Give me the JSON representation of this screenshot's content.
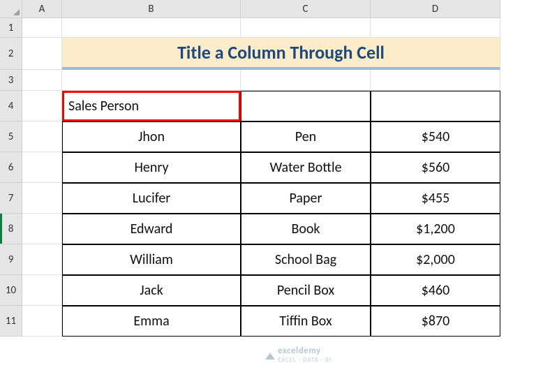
{
  "columns": {
    "A": "A",
    "B": "B",
    "C": "C",
    "D": "D"
  },
  "rows": {
    "r1": "1",
    "r2": "2",
    "r3": "3",
    "r4": "4",
    "r5": "5",
    "r6": "6",
    "r7": "7",
    "r8": "8",
    "r9": "9",
    "r10": "10",
    "r11": "11"
  },
  "title": "Title a Column Through Cell",
  "header_b4": "Sales Person",
  "data": [
    {
      "b": "Jhon",
      "c": "Pen",
      "d": "$540"
    },
    {
      "b": "Henry",
      "c": "Water Bottle",
      "d": "$560"
    },
    {
      "b": "Lucifer",
      "c": "Paper",
      "d": "$455"
    },
    {
      "b": "Edward",
      "c": "Book",
      "d": "$1,200"
    },
    {
      "b": "William",
      "c": "School Bag",
      "d": "$2,000"
    },
    {
      "b": "Jack",
      "c": "Pencil Box",
      "d": "$460"
    },
    {
      "b": "Emma",
      "c": "Tiffin Box",
      "d": "$870"
    }
  ],
  "watermark": {
    "brand": "exceldemy",
    "tag": "EXCEL · DATA · BI"
  },
  "chart_data": {
    "type": "table",
    "title": "Title a Column Through Cell",
    "columns": [
      "Sales Person",
      "",
      ""
    ],
    "rows": [
      [
        "Jhon",
        "Pen",
        "$540"
      ],
      [
        "Henry",
        "Water Bottle",
        "$560"
      ],
      [
        "Lucifer",
        "Paper",
        "$455"
      ],
      [
        "Edward",
        "Book",
        "$1,200"
      ],
      [
        "William",
        "School Bag",
        "$2,000"
      ],
      [
        "Jack",
        "Pencil Box",
        "$460"
      ],
      [
        "Emma",
        "Tiffin Box",
        "$870"
      ]
    ]
  }
}
